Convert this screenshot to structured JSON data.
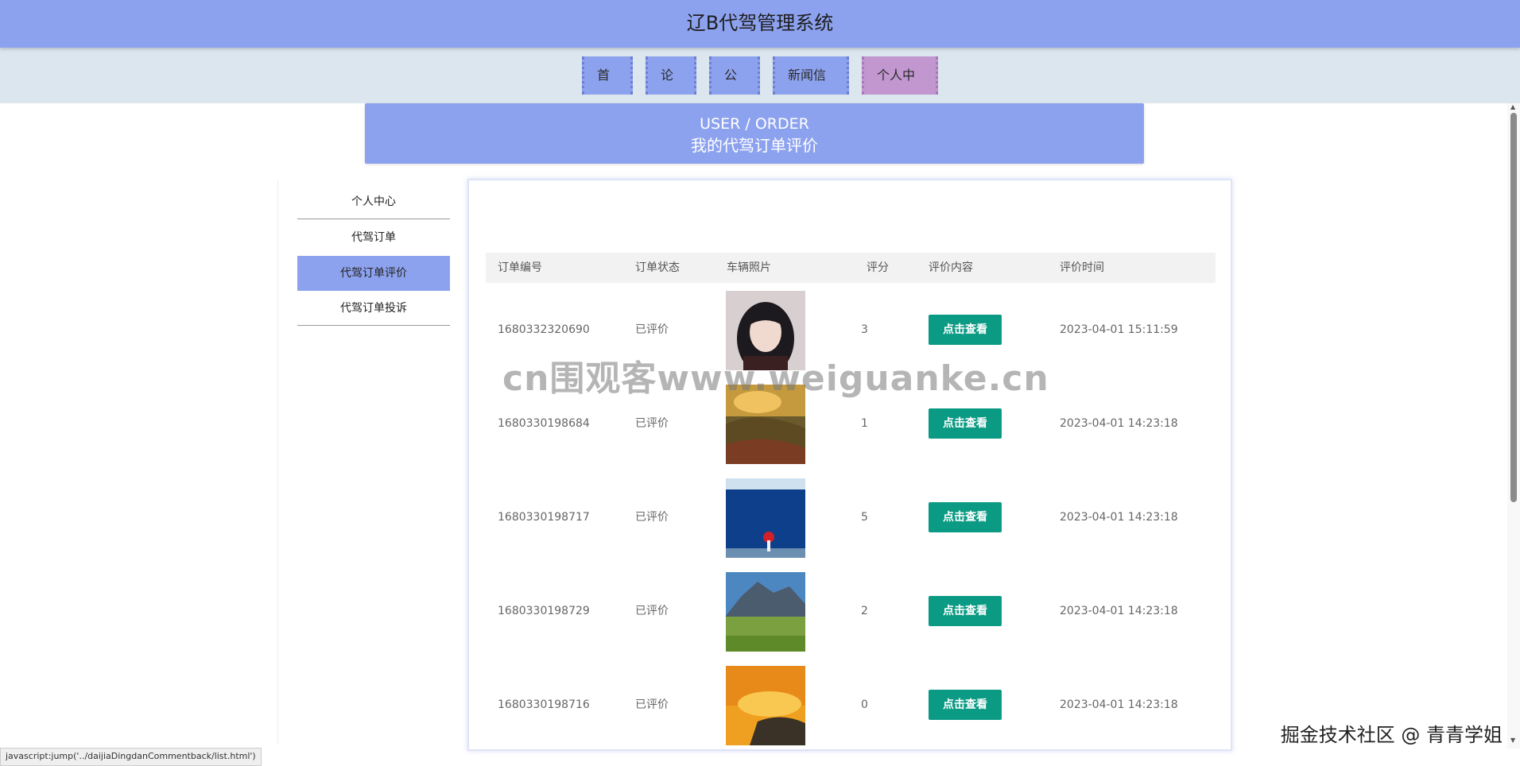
{
  "header": {
    "title": "辽B代驾管理系统"
  },
  "nav": {
    "items": [
      "首页",
      "论坛",
      "公告",
      "新闻信息",
      "个人中心"
    ],
    "active_index": 4
  },
  "banner": {
    "en": "USER / ORDER",
    "zh": "我的代驾订单评价"
  },
  "sidebar": {
    "items": [
      "个人中心",
      "代驾订单",
      "代驾订单评价",
      "代驾订单投诉"
    ],
    "active_index": 2
  },
  "table": {
    "columns": [
      "订单编号",
      "订单状态",
      "车辆照片",
      "评分",
      "评价内容",
      "评价时间"
    ],
    "rows": [
      {
        "order_no": "1680332320690",
        "status": "已评价",
        "photo": "portrait",
        "score": "3",
        "action": "点击查看",
        "time": "2023-04-01 15:11:59"
      },
      {
        "order_no": "1680330198684",
        "status": "已评价",
        "photo": "sunset-hills",
        "score": "1",
        "action": "点击查看",
        "time": "2023-04-01 14:23:18"
      },
      {
        "order_no": "1680330198717",
        "status": "已评价",
        "photo": "blue-sea",
        "score": "5",
        "action": "点击查看",
        "time": "2023-04-01 14:23:18"
      },
      {
        "order_no": "1680330198729",
        "status": "已评价",
        "photo": "mountain-meadow",
        "score": "2",
        "action": "点击查看",
        "time": "2023-04-01 14:23:18"
      },
      {
        "order_no": "1680330198716",
        "status": "已评价",
        "photo": "ocean-sunset",
        "score": "0",
        "action": "点击查看",
        "time": "2023-04-01 14:23:18"
      }
    ]
  },
  "watermark": "cn围观客www.weiguanke.cn",
  "credit": "掘金技术社区 @ 青青学姐",
  "status_bar": "javascript:jump('../daijiaDingdanCommentback/list.html')",
  "colors": {
    "primary": "#8da2ee",
    "active_nav": "#c297d0",
    "button": "#0b9a83",
    "nav_band": "#dbe6ee"
  }
}
